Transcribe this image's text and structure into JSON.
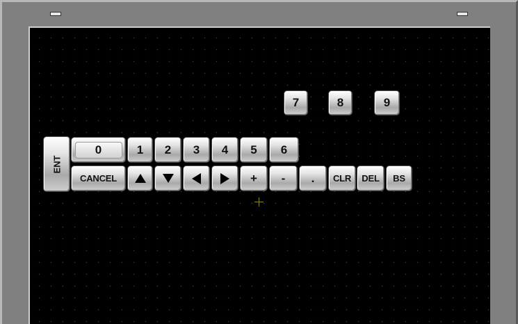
{
  "keypad": {
    "ent": "ENT",
    "zero": "0",
    "digits_row": [
      "1",
      "2",
      "3",
      "4",
      "5",
      "6"
    ],
    "digits_top": [
      "7",
      "8",
      "9"
    ],
    "cancel": "CANCEL",
    "arrows": {
      "up": "arrow-up-icon",
      "down": "arrow-down-icon",
      "left": "arrow-left-icon",
      "right": "arrow-right-icon"
    },
    "plus": "+",
    "minus": "-",
    "dot": ".",
    "clr": "CLR",
    "del": "DEL",
    "bs": "BS"
  },
  "colors": {
    "screen_background": "#000000",
    "frame": "#808080",
    "crosshair": "#8a8a2a"
  }
}
